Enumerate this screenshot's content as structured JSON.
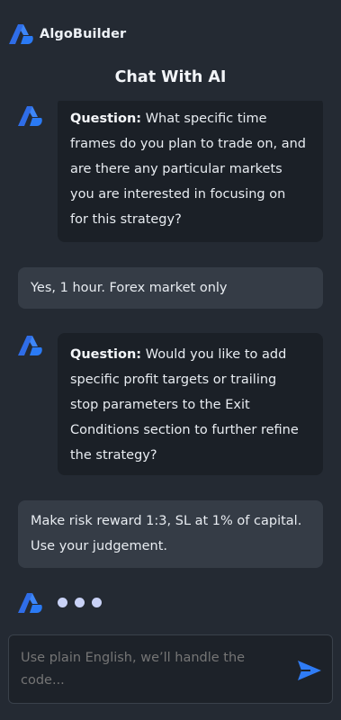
{
  "header": {
    "brand_name": "AlgoBuilder",
    "title": "Chat With AI",
    "logo_icon": "algobuilder-logo-icon"
  },
  "messages": [
    {
      "role": "ai",
      "label": "Question:",
      "lines": [
        " What specific time",
        "frames do you plan to trade on, and",
        "are there any particular markets",
        "you are interested in focusing on",
        "for this strategy?"
      ]
    },
    {
      "role": "user",
      "lines": [
        "Yes, 1 hour. Forex market only"
      ]
    },
    {
      "role": "ai",
      "label": "Question:",
      "lines": [
        " Would you like to add",
        "specific profit targets or trailing",
        "stop parameters to the Exit",
        "Conditions section to further refine",
        "the strategy?"
      ]
    },
    {
      "role": "user",
      "lines": [
        "Make risk reward 1:3, SL at 1% of capital.",
        "Use your judgement."
      ]
    }
  ],
  "typing_indicator": {
    "dots": 3,
    "color": "#c9d2f7"
  },
  "composer": {
    "placeholder": "Use plain English, we’ll handle the code...",
    "send_icon": "send-icon"
  },
  "colors": {
    "background": "#242a33",
    "ai_bubble": "#1b2027",
    "user_bubble": "#353c46",
    "accent": "#2f7cf6"
  }
}
